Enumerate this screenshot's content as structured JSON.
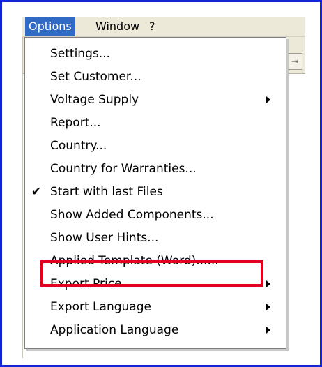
{
  "menubar": {
    "items": [
      {
        "label": "Options",
        "active": true
      },
      {
        "label": "Window",
        "active": false
      },
      {
        "label": "?",
        "active": false
      }
    ]
  },
  "menu": {
    "items": [
      {
        "label": "Settings...",
        "checked": false,
        "submenu": false
      },
      {
        "label": "Set Customer...",
        "checked": false,
        "submenu": false
      },
      {
        "label": "Voltage Supply",
        "checked": false,
        "submenu": true
      },
      {
        "label": "Report...",
        "checked": false,
        "submenu": false
      },
      {
        "label": "Country...",
        "checked": false,
        "submenu": false
      },
      {
        "label": "Country for Warranties...",
        "checked": false,
        "submenu": false
      },
      {
        "label": "Start with last Files",
        "checked": true,
        "submenu": false
      },
      {
        "label": "Show Added Components...",
        "checked": false,
        "submenu": false
      },
      {
        "label": "Show User Hints...",
        "checked": false,
        "submenu": false
      },
      {
        "label": "Applied Template (Word)......",
        "checked": false,
        "submenu": false,
        "highlighted": true
      },
      {
        "label": "Export Price",
        "checked": false,
        "submenu": true
      },
      {
        "label": "Export Language",
        "checked": false,
        "submenu": true
      },
      {
        "label": "Application Language",
        "checked": false,
        "submenu": true
      }
    ],
    "check_glyph": "✔"
  },
  "colors": {
    "frame_border": "#1226d8",
    "menu_highlight": "#316ac5",
    "annotation": "#e4001d"
  }
}
